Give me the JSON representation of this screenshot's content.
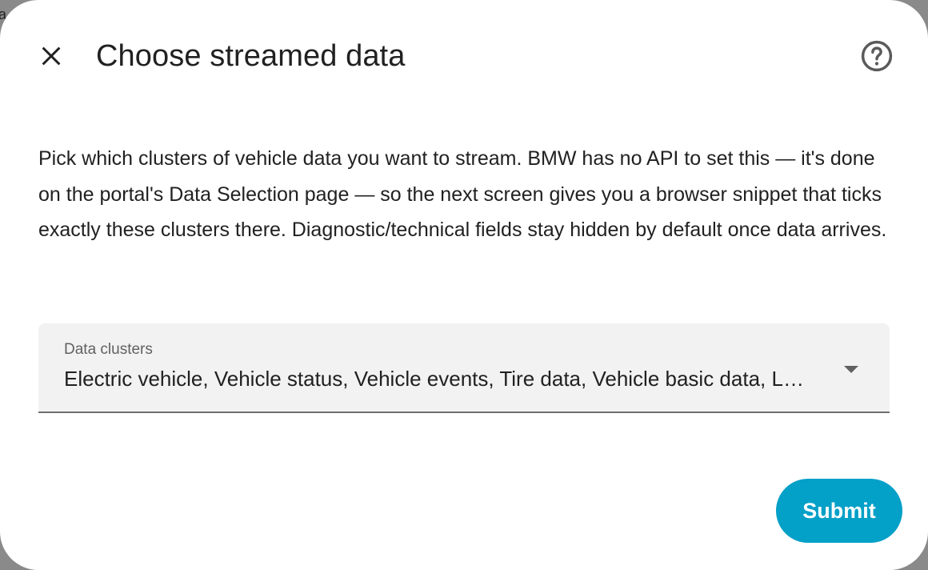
{
  "background": {
    "edge_text": "a"
  },
  "dialog": {
    "title": "Choose streamed data",
    "close_icon": "close-icon",
    "help_icon": "help-circle-icon",
    "description": "Pick which clusters of vehicle data you want to stream. BMW has no API to set this — it's done on the portal's Data Selection page — so the next screen gives you a browser snippet that ticks exactly these clusters there. Diagnostic/technical fields stay hidden by default once data arrives.",
    "field": {
      "label": "Data clusters",
      "value": "Electric vehicle, Vehicle status, Vehicle events, Tire data, Vehicle basic data, Location",
      "arrow_icon": "dropdown-arrow-icon"
    },
    "submit_label": "Submit"
  },
  "colors": {
    "accent": "#03a0c8",
    "text": "#212121",
    "field_bg": "#f2f2f2",
    "field_underline": "#6f6f6f"
  }
}
